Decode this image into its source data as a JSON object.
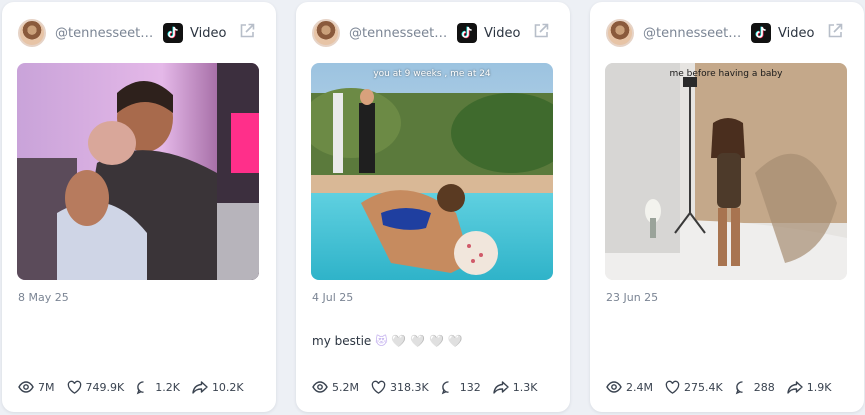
{
  "cards": [
    {
      "handle": "@tennesseethr...",
      "type_label": "Video",
      "overlay_text": "",
      "date": "8 May 25",
      "caption": "",
      "stats": {
        "views": "7M",
        "likes": "749.9K",
        "comments": "1.2K",
        "shares": "10.2K"
      }
    },
    {
      "handle": "@tennesseethr...",
      "type_label": "Video",
      "overlay_text": "you at 9 weeks , me at 24",
      "date": "4 Jul 25",
      "caption": "my bestie",
      "caption_emojis": "😻 🤍 🤍 🤍 🤍",
      "stats": {
        "views": "5.2M",
        "likes": "318.3K",
        "comments": "132",
        "shares": "1.3K"
      }
    },
    {
      "handle": "@tennesseethr...",
      "type_label": "Video",
      "overlay_text": "me before having a baby",
      "date": "23 Jun 25",
      "caption": "",
      "stats": {
        "views": "2.4M",
        "likes": "275.4K",
        "comments": "288",
        "shares": "1.9K"
      }
    }
  ],
  "colors": {
    "page_bg": "#edf0f5",
    "card_bg": "#ffffff",
    "muted_text": "#7b8594"
  },
  "icons": [
    "tiktok-icon",
    "external-link-icon",
    "eye-icon",
    "heart-icon",
    "comment-icon",
    "share-icon"
  ]
}
